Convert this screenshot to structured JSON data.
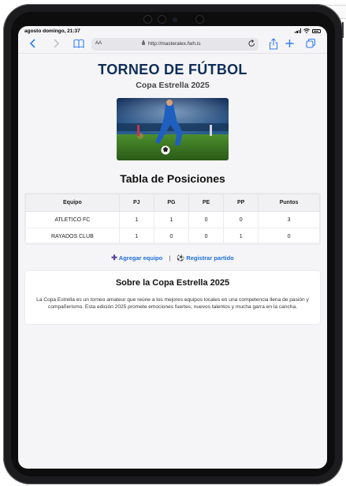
{
  "status_bar": {
    "time": "agosto domingo, 21:37"
  },
  "browser": {
    "text_size_label": "AA",
    "url": "http://masteralex.fwh.is",
    "icons": [
      "back-icon",
      "forward-icon",
      "bookmarks-icon",
      "lock-icon",
      "reload-icon",
      "share-icon",
      "new-tab-icon",
      "tabs-icon"
    ]
  },
  "page": {
    "title": "TORNEO DE FÚTBOL",
    "subtitle": "Copa Estrella 2025",
    "standings_title": "Tabla de Posiciones",
    "table": {
      "headers": [
        "Equipo",
        "PJ",
        "PG",
        "PE",
        "PP",
        "Puntos"
      ],
      "rows": [
        [
          "ATLETICO FC",
          "1",
          "1",
          "0",
          "0",
          "3"
        ],
        [
          "RAYADOS CLUB",
          "1",
          "0",
          "0",
          "1",
          "0"
        ]
      ]
    },
    "actions": {
      "add_team": "Agregar equipo",
      "separator": "|",
      "register_match": "Registrar partido"
    },
    "about": {
      "title": "Sobre la Copa Estrella 2025",
      "text": "La Copa Estrella es un torneo amateur que reúne a los mejores equipos locales en una competencia llena de pasión y compañerismo. Esta edición 2025 promete emociones fuertes, nuevos talentos y mucha garra en la cancha."
    }
  },
  "colors": {
    "title": "#0f2e58",
    "link": "#1e6fd9",
    "accent": "#2f7cf6"
  }
}
